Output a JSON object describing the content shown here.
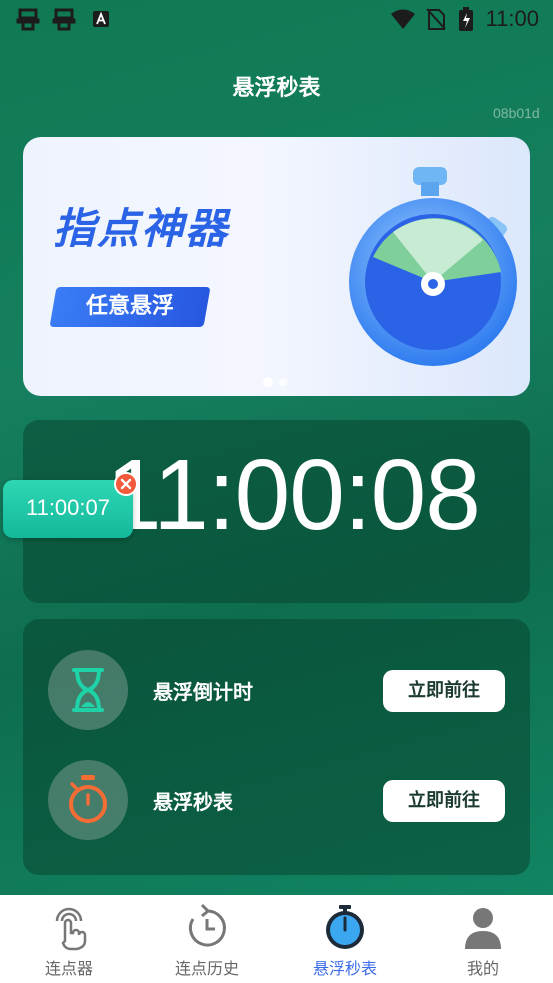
{
  "status_bar": {
    "time": "11:00",
    "icons": [
      "app-bug-icon",
      "app-bug-icon",
      "app-a-icon",
      "wifi-icon",
      "no-sim-icon",
      "battery-icon"
    ]
  },
  "header": {
    "title": "悬浮秒表",
    "side_id": "08b01d"
  },
  "banner": {
    "title": "指点神器",
    "pill_label": "任意悬浮",
    "page_index": 1,
    "page_count": 2,
    "art_icon": "stopwatch-icon"
  },
  "clock": {
    "time": "11:00:08"
  },
  "floating_timer": {
    "time": "11:00:07",
    "close_icon": "close-icon"
  },
  "tools": [
    {
      "label": "悬浮倒计时",
      "button": "立即前往",
      "icon": "hourglass-icon",
      "icon_color": "#1fd3a8"
    },
    {
      "label": "悬浮秒表",
      "button": "立即前往",
      "icon": "stopwatch-icon",
      "icon_color": "#f56c34"
    }
  ],
  "tabbar": {
    "tabs": [
      {
        "label": "连点器",
        "icon": "tap-hand-icon",
        "active": false
      },
      {
        "label": "连点历史",
        "icon": "history-icon",
        "active": false
      },
      {
        "label": "悬浮秒表",
        "icon": "stopwatch-icon",
        "active": true
      },
      {
        "label": "我的",
        "icon": "profile-icon",
        "active": false
      }
    ],
    "active_color": "#3b6be8"
  }
}
